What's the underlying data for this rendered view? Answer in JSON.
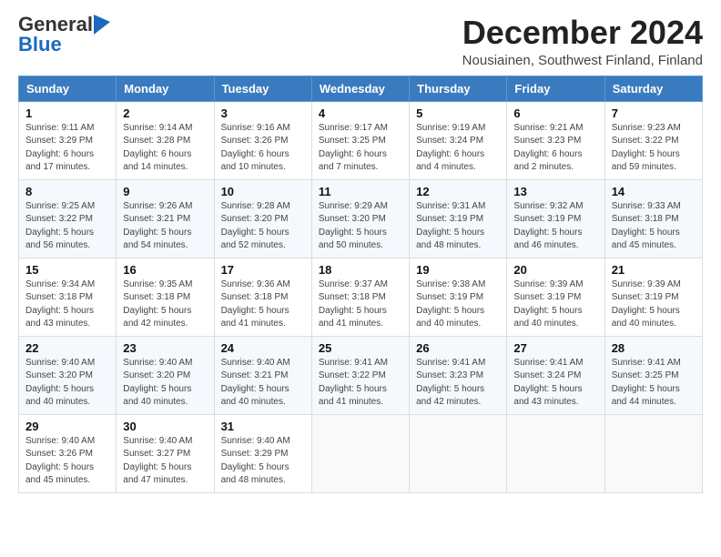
{
  "logo": {
    "general": "General",
    "blue": "Blue"
  },
  "title": {
    "month": "December 2024",
    "location": "Nousiainen, Southwest Finland, Finland"
  },
  "weekdays": [
    "Sunday",
    "Monday",
    "Tuesday",
    "Wednesday",
    "Thursday",
    "Friday",
    "Saturday"
  ],
  "weeks": [
    [
      {
        "day": "1",
        "sunrise": "9:11 AM",
        "sunset": "3:29 PM",
        "daylight": "6 hours and 17 minutes."
      },
      {
        "day": "2",
        "sunrise": "9:14 AM",
        "sunset": "3:28 PM",
        "daylight": "6 hours and 14 minutes."
      },
      {
        "day": "3",
        "sunrise": "9:16 AM",
        "sunset": "3:26 PM",
        "daylight": "6 hours and 10 minutes."
      },
      {
        "day": "4",
        "sunrise": "9:17 AM",
        "sunset": "3:25 PM",
        "daylight": "6 hours and 7 minutes."
      },
      {
        "day": "5",
        "sunrise": "9:19 AM",
        "sunset": "3:24 PM",
        "daylight": "6 hours and 4 minutes."
      },
      {
        "day": "6",
        "sunrise": "9:21 AM",
        "sunset": "3:23 PM",
        "daylight": "6 hours and 2 minutes."
      },
      {
        "day": "7",
        "sunrise": "9:23 AM",
        "sunset": "3:22 PM",
        "daylight": "5 hours and 59 minutes."
      }
    ],
    [
      {
        "day": "8",
        "sunrise": "9:25 AM",
        "sunset": "3:22 PM",
        "daylight": "5 hours and 56 minutes."
      },
      {
        "day": "9",
        "sunrise": "9:26 AM",
        "sunset": "3:21 PM",
        "daylight": "5 hours and 54 minutes."
      },
      {
        "day": "10",
        "sunrise": "9:28 AM",
        "sunset": "3:20 PM",
        "daylight": "5 hours and 52 minutes."
      },
      {
        "day": "11",
        "sunrise": "9:29 AM",
        "sunset": "3:20 PM",
        "daylight": "5 hours and 50 minutes."
      },
      {
        "day": "12",
        "sunrise": "9:31 AM",
        "sunset": "3:19 PM",
        "daylight": "5 hours and 48 minutes."
      },
      {
        "day": "13",
        "sunrise": "9:32 AM",
        "sunset": "3:19 PM",
        "daylight": "5 hours and 46 minutes."
      },
      {
        "day": "14",
        "sunrise": "9:33 AM",
        "sunset": "3:18 PM",
        "daylight": "5 hours and 45 minutes."
      }
    ],
    [
      {
        "day": "15",
        "sunrise": "9:34 AM",
        "sunset": "3:18 PM",
        "daylight": "5 hours and 43 minutes."
      },
      {
        "day": "16",
        "sunrise": "9:35 AM",
        "sunset": "3:18 PM",
        "daylight": "5 hours and 42 minutes."
      },
      {
        "day": "17",
        "sunrise": "9:36 AM",
        "sunset": "3:18 PM",
        "daylight": "5 hours and 41 minutes."
      },
      {
        "day": "18",
        "sunrise": "9:37 AM",
        "sunset": "3:18 PM",
        "daylight": "5 hours and 41 minutes."
      },
      {
        "day": "19",
        "sunrise": "9:38 AM",
        "sunset": "3:19 PM",
        "daylight": "5 hours and 40 minutes."
      },
      {
        "day": "20",
        "sunrise": "9:39 AM",
        "sunset": "3:19 PM",
        "daylight": "5 hours and 40 minutes."
      },
      {
        "day": "21",
        "sunrise": "9:39 AM",
        "sunset": "3:19 PM",
        "daylight": "5 hours and 40 minutes."
      }
    ],
    [
      {
        "day": "22",
        "sunrise": "9:40 AM",
        "sunset": "3:20 PM",
        "daylight": "5 hours and 40 minutes."
      },
      {
        "day": "23",
        "sunrise": "9:40 AM",
        "sunset": "3:20 PM",
        "daylight": "5 hours and 40 minutes."
      },
      {
        "day": "24",
        "sunrise": "9:40 AM",
        "sunset": "3:21 PM",
        "daylight": "5 hours and 40 minutes."
      },
      {
        "day": "25",
        "sunrise": "9:41 AM",
        "sunset": "3:22 PM",
        "daylight": "5 hours and 41 minutes."
      },
      {
        "day": "26",
        "sunrise": "9:41 AM",
        "sunset": "3:23 PM",
        "daylight": "5 hours and 42 minutes."
      },
      {
        "day": "27",
        "sunrise": "9:41 AM",
        "sunset": "3:24 PM",
        "daylight": "5 hours and 43 minutes."
      },
      {
        "day": "28",
        "sunrise": "9:41 AM",
        "sunset": "3:25 PM",
        "daylight": "5 hours and 44 minutes."
      }
    ],
    [
      {
        "day": "29",
        "sunrise": "9:40 AM",
        "sunset": "3:26 PM",
        "daylight": "5 hours and 45 minutes."
      },
      {
        "day": "30",
        "sunrise": "9:40 AM",
        "sunset": "3:27 PM",
        "daylight": "5 hours and 47 minutes."
      },
      {
        "day": "31",
        "sunrise": "9:40 AM",
        "sunset": "3:29 PM",
        "daylight": "5 hours and 48 minutes."
      },
      null,
      null,
      null,
      null
    ]
  ]
}
